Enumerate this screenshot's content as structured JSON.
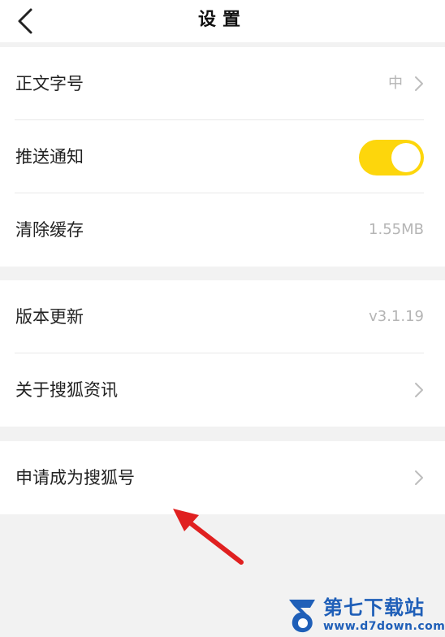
{
  "header": {
    "title": "设置",
    "back_icon": "chevron-left-icon"
  },
  "groups": [
    {
      "rows": [
        {
          "label": "正文字号",
          "value": "中",
          "chevron": true
        },
        {
          "label": "推送通知",
          "toggle_on": true
        },
        {
          "label": "清除缓存",
          "value": "1.55MB"
        }
      ]
    },
    {
      "rows": [
        {
          "label": "版本更新",
          "value": "v3.1.19"
        },
        {
          "label": "关于搜狐资讯",
          "chevron": true
        }
      ]
    },
    {
      "rows": [
        {
          "label": "申请成为搜狐号",
          "chevron": true
        }
      ]
    }
  ],
  "colors": {
    "toggle_on": "#fdd60c",
    "background": "#f2f2f2",
    "annotation_arrow": "#e02020",
    "watermark": "#1f5fb8"
  },
  "watermark": {
    "name": "第七下载站",
    "url": "www.d7down.com"
  }
}
